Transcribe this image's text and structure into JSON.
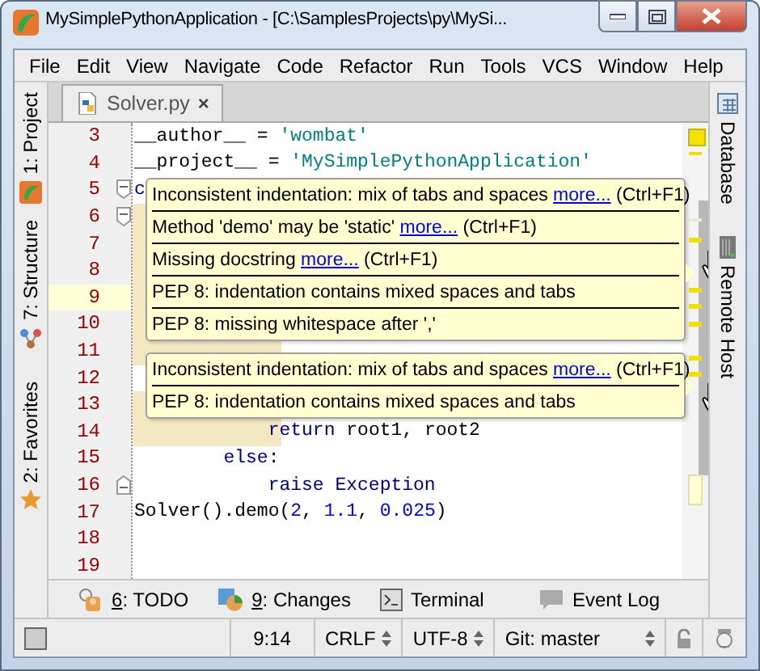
{
  "window": {
    "title": "MySimplePythonApplication - [C:\\SamplesProjects\\py\\MySi..."
  },
  "menu": [
    {
      "label": "File"
    },
    {
      "label": "Edit"
    },
    {
      "label": "View"
    },
    {
      "label": "Navigate"
    },
    {
      "label": "Code"
    },
    {
      "label": "Refactor"
    },
    {
      "label": "Run"
    },
    {
      "label": "Tools"
    },
    {
      "label": "VCS"
    },
    {
      "label": "Window"
    },
    {
      "label": "Help"
    }
  ],
  "tabs": [
    {
      "label": "Solver.py",
      "close": "×",
      "selected": true
    }
  ],
  "left_tools": [
    {
      "label": "1: Project",
      "kind": "project"
    },
    {
      "label": "7: Structure",
      "kind": "structure"
    },
    {
      "label": "2: Favorites",
      "kind": "favorites"
    }
  ],
  "right_tools": [
    {
      "label": "Database",
      "kind": "database"
    },
    {
      "label": "Remote Host",
      "kind": "remote"
    }
  ],
  "lines": [
    {
      "number": "3",
      "tokens": [
        {
          "text": "__author__ = ",
          "kind": "plain"
        },
        {
          "text": "'wombat'",
          "kind": "string"
        }
      ]
    },
    {
      "number": "4",
      "tokens": [
        {
          "text": "__project__ = ",
          "kind": "plain"
        },
        {
          "text": "'MySimplePythonApplication'",
          "kind": "string"
        }
      ]
    },
    {
      "number": "5",
      "fold_start": true,
      "tokens": [
        {
          "text": "c",
          "kind": "keyword"
        }
      ]
    },
    {
      "number": "6",
      "fold_start": true,
      "warning": true
    },
    {
      "number": "7",
      "warning": true
    },
    {
      "number": "8",
      "warning": true
    },
    {
      "number": "9",
      "current": true,
      "warning": true
    },
    {
      "number": "10",
      "warning": true
    },
    {
      "number": "11",
      "warning": true
    },
    {
      "number": "12"
    },
    {
      "number": "13",
      "warning": true
    },
    {
      "number": "14",
      "warning": true,
      "tokens": [
        {
          "text": "            return",
          "kind": "keyword"
        },
        {
          "text": " root1, root2",
          "kind": "plain"
        }
      ]
    },
    {
      "number": "15",
      "tokens": [
        {
          "text": "        else",
          "kind": "keyword"
        },
        {
          "text": ":",
          "kind": "plain"
        }
      ]
    },
    {
      "number": "16",
      "fold_end": true,
      "tokens": [
        {
          "text": "            raise Exception",
          "kind": "keyword"
        }
      ]
    },
    {
      "number": "17",
      "tokens": [
        {
          "text": "Solver().demo(",
          "kind": "plain"
        },
        {
          "text": "2",
          "kind": "number"
        },
        {
          "text": ", ",
          "kind": "plain"
        },
        {
          "text": "1.1",
          "kind": "number"
        },
        {
          "text": ", ",
          "kind": "plain"
        },
        {
          "text": "0.025",
          "kind": "number"
        },
        {
          "text": ")",
          "kind": "plain"
        }
      ]
    },
    {
      "number": "18"
    },
    {
      "number": "19"
    }
  ],
  "tooltips": [
    {
      "rows": [
        {
          "text": "Inconsistent indentation: mix of tabs and spaces",
          "link": "more...",
          "shortcut": "(Ctrl+F1)"
        },
        {
          "text": "Method 'demo' may be 'static'",
          "link": "more...",
          "shortcut": "(Ctrl+F1)"
        },
        {
          "text": "Missing docstring",
          "link": "more...",
          "shortcut": "(Ctrl+F1)"
        },
        {
          "text": "PEP 8: indentation contains mixed spaces and tabs"
        },
        {
          "text": "PEP 8: missing whitespace after ','"
        }
      ]
    },
    {
      "rows": [
        {
          "text": "Inconsistent indentation: mix of tabs and spaces",
          "link": "more...",
          "shortcut": "(Ctrl+F1)"
        },
        {
          "text": "PEP 8: indentation contains mixed spaces and tabs"
        }
      ]
    }
  ],
  "tool_windows": [
    {
      "key": "6",
      "label": ": TODO",
      "kind": "todo"
    },
    {
      "key": "9",
      "label": ": Changes",
      "kind": "changes"
    },
    {
      "label": "Terminal",
      "kind": "terminal"
    },
    {
      "label": "Event Log",
      "kind": "eventlog"
    }
  ],
  "status": {
    "position": "9:14",
    "line_separator": "CRLF",
    "encoding": "UTF-8",
    "vcs": "Git: master"
  }
}
